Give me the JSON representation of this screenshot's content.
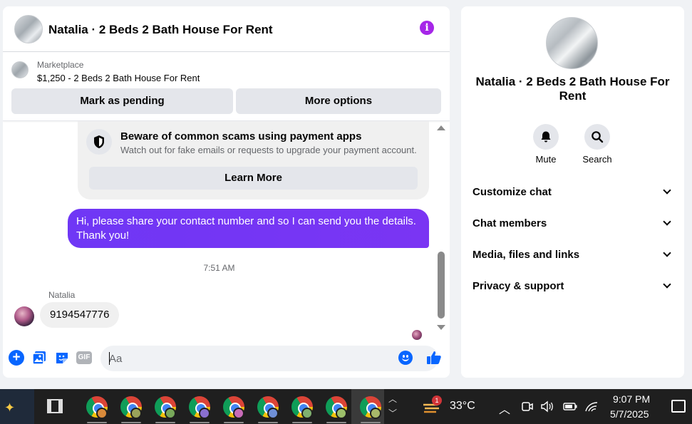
{
  "chat": {
    "header_title": "Natalia · 2 Beds 2 Bath House For Rent",
    "info_icon": "i",
    "marketplace": {
      "label": "Marketplace",
      "listing": "$1,250 - 2 Beds 2 Bath House For Rent",
      "pending_button": "Mark as pending",
      "more_button": "More options"
    },
    "scam_notice": {
      "title": "Beware of common scams using payment apps",
      "description": "Watch out for fake emails or requests to upgrade your payment account.",
      "button": "Learn More"
    },
    "outgoing_message": "Hi, please share your contact number and so I can send you the details. Thank you!",
    "timestamp": "7:51 AM",
    "sender_name": "Natalia",
    "incoming_message": "9194547776",
    "composer": {
      "placeholder": "Aa",
      "gif_label": "GIF"
    },
    "accent_color": "#0866ff",
    "bubble_color": "#7131f5"
  },
  "details": {
    "title": "Natalia · 2 Beds 2 Bath House For Rent",
    "actions": [
      {
        "label": "Mute",
        "icon": "bell-icon"
      },
      {
        "label": "Search",
        "icon": "search-icon"
      }
    ],
    "sections": [
      {
        "label": "Customize chat"
      },
      {
        "label": "Chat members"
      },
      {
        "label": "Media, files and links"
      },
      {
        "label": "Privacy & support"
      }
    ]
  },
  "taskbar": {
    "temperature": "33°C",
    "weather_badge": "1",
    "time": "9:07 PM",
    "date": "5/7/2025",
    "chrome_windows": 9
  }
}
